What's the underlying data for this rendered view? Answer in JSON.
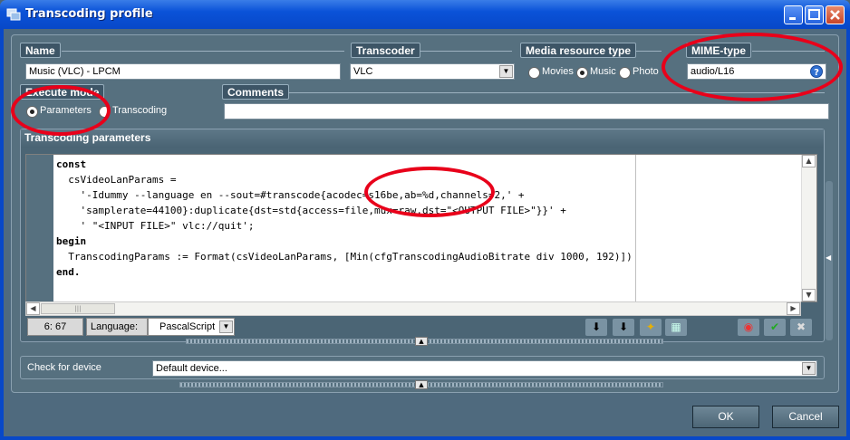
{
  "window": {
    "title": "Transcoding profile"
  },
  "groups": {
    "name_label": "Name",
    "transcoder_label": "Transcoder",
    "media_type_label": "Media resource type",
    "mime_label": "MIME-type",
    "exec_mode_label": "Execute mode",
    "comments_label": "Comments",
    "params_label": "Transcoding parameters"
  },
  "fields": {
    "name_value": "Music (VLC) - LPCM",
    "transcoder_value": "VLC",
    "mime_value": "audio/L16",
    "comments_value": ""
  },
  "media_types": {
    "movies": "Movies",
    "music": "Music",
    "photo": "Photo",
    "selected": "Music"
  },
  "exec_modes": {
    "parameters": "Parameters",
    "transcoding": "Transcoding",
    "selected": "Parameters"
  },
  "code_lines": [
    "const",
    "  csVideoLanParams =",
    "    '-Idummy --language en --sout=#transcode{acodec=s16be,ab=%d,channels=2,' +",
    "    'samplerate=44100}:duplicate{dst=std{access=file,mux=raw,dst=\"<OUTPUT FILE>\"}}' +",
    "    ' \"<INPUT FILE>\" vlc://quit';",
    "begin",
    "  TranscodingParams := Format(csVideoLanParams, [Min(cfgTranscodingAudioBitrate div 1000, 192)])",
    "end."
  ],
  "status_bar": {
    "cursor_pos": "6: 67",
    "language_label": "Language:",
    "language_value": "PascalScript"
  },
  "device": {
    "label": "Check for device",
    "value": "Default device..."
  },
  "buttons": {
    "ok": "OK",
    "cancel": "Cancel"
  },
  "colors": {
    "annotation": "#e8001a",
    "titlebar": "#0a52d8"
  }
}
